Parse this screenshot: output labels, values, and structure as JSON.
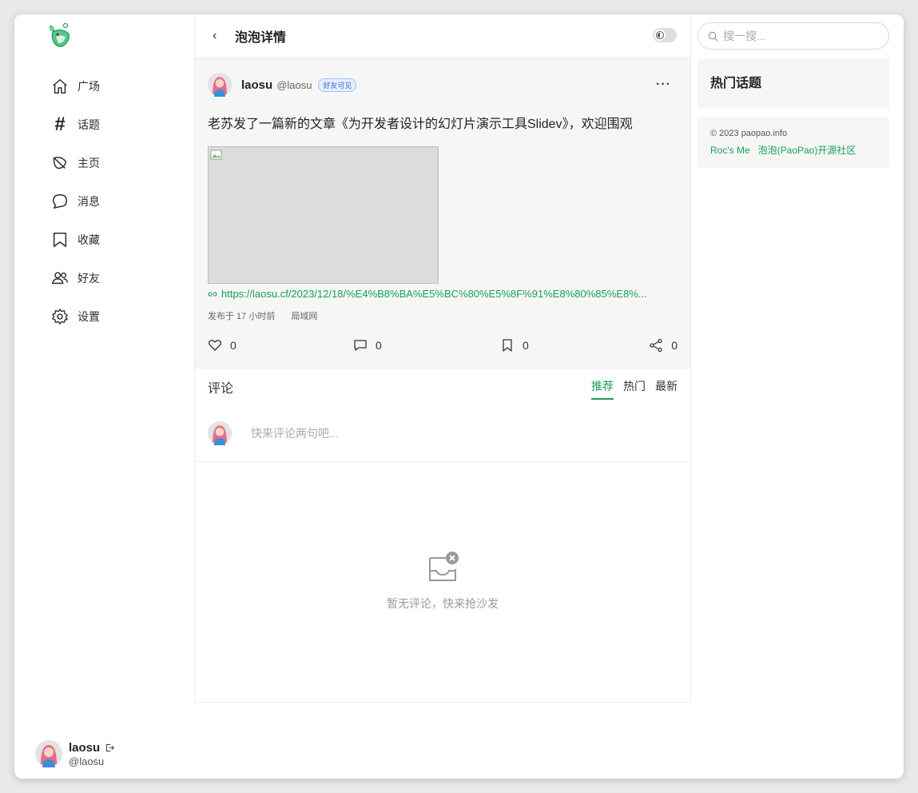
{
  "nav": {
    "items": [
      {
        "label": "广场",
        "icon": "home-icon"
      },
      {
        "label": "话题",
        "icon": "hash-icon"
      },
      {
        "label": "主页",
        "icon": "leaf-icon"
      },
      {
        "label": "消息",
        "icon": "chat-bubble-icon"
      },
      {
        "label": "收藏",
        "icon": "bookmark-icon"
      },
      {
        "label": "好友",
        "icon": "friends-icon"
      },
      {
        "label": "设置",
        "icon": "gear-icon"
      }
    ]
  },
  "user": {
    "name": "laosu",
    "handle": "@laosu"
  },
  "header": {
    "title": "泡泡详情"
  },
  "post": {
    "author": "laosu",
    "handle": "@laosu",
    "visibility": "好友可见",
    "more": "···",
    "text": "老苏发了一篇新的文章《为开发者设计的幻灯片演示工具Slidev》，欢迎围观",
    "link": "https://laosu.cf/2023/12/18/%E4%B8%BA%E5%BC%80%E5%8F%91%E8%80%85%E8%...",
    "published": "发布于 17 小时前",
    "location": "局域网",
    "likes": "0",
    "comments": "0",
    "collections": "0",
    "shares": "0"
  },
  "comments": {
    "title": "评论",
    "sort": {
      "recommend": "推荐",
      "hot": "热门",
      "latest": "最新"
    },
    "placeholder": "快来评论两句吧...",
    "empty": "暂无评论，快来抢沙发"
  },
  "search": {
    "placeholder": "搜一搜..."
  },
  "sidebar": {
    "hot_title": "热门话题",
    "copyright": "© 2023 paopao.info",
    "links": [
      "Roc's Me",
      "泡泡(PaoPao)开源社区"
    ]
  },
  "colors": {
    "accent": "#18a058",
    "panel": "#f6f6f6"
  }
}
